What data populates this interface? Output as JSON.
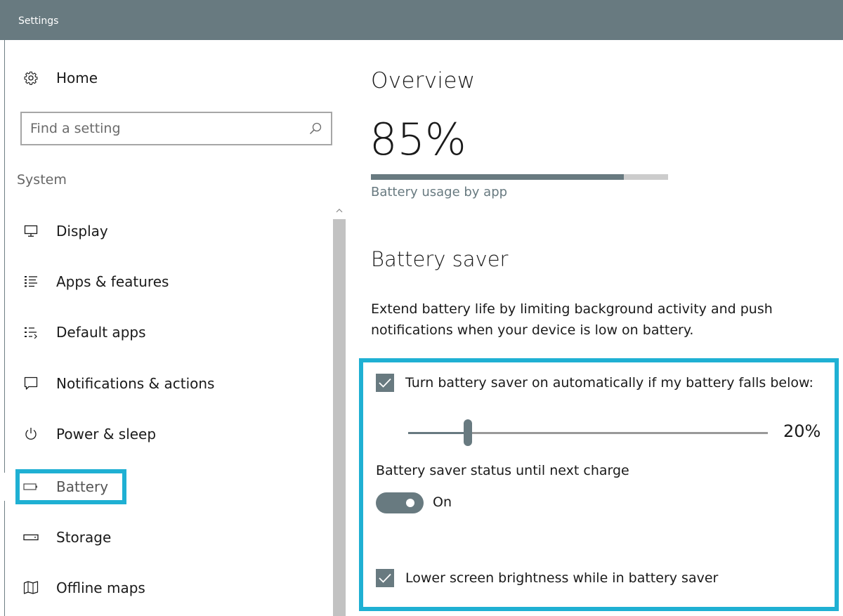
{
  "window": {
    "title": "Settings"
  },
  "sidebar": {
    "home_label": "Home",
    "search": {
      "placeholder": "Find a setting"
    },
    "section_label": "System",
    "items": [
      {
        "label": "Display",
        "icon": "monitor-icon"
      },
      {
        "label": "Apps & features",
        "icon": "list-icon"
      },
      {
        "label": "Default apps",
        "icon": "default-apps-icon"
      },
      {
        "label": "Notifications & actions",
        "icon": "message-icon"
      },
      {
        "label": "Power & sleep",
        "icon": "power-icon"
      },
      {
        "label": "Battery",
        "icon": "battery-icon",
        "selected": true
      },
      {
        "label": "Storage",
        "icon": "storage-icon"
      },
      {
        "label": "Offline maps",
        "icon": "map-icon"
      }
    ]
  },
  "main": {
    "overview_heading": "Overview",
    "battery_percent": "85%",
    "charge_level": 0.85,
    "usage_link": "Battery usage by app",
    "saver_heading": "Battery saver",
    "saver_description": "Extend battery life by limiting background activity and push notifications when your device is low on battery.",
    "auto_on": {
      "label": "Turn battery saver on automatically if my battery falls below:",
      "checked": true
    },
    "threshold": {
      "value_text": "20%",
      "level": 0.2
    },
    "status_label": "Battery saver status until next charge",
    "status_toggle": {
      "state_text": "On",
      "on": true
    },
    "lower_brightness": {
      "label": "Lower screen brightness while in battery saver",
      "checked": true
    }
  },
  "colors": {
    "accent": "#687a80",
    "highlight": "#1fb0d3",
    "titlebar": "#687a80"
  }
}
